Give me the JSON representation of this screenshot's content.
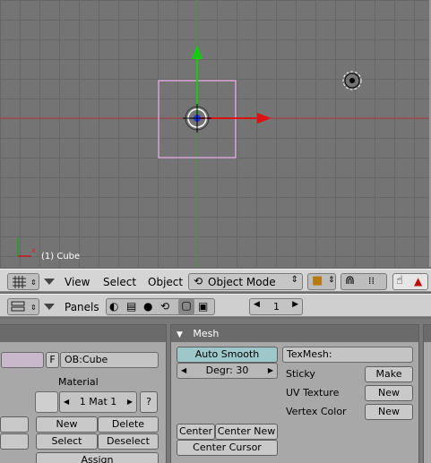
{
  "viewport": {
    "object_label": "(1) Cube"
  },
  "header": {
    "menus": [
      "View",
      "Select",
      "Object"
    ],
    "mode_label": "Object Mode"
  },
  "buttons_header": {
    "panels_label": "Panels",
    "frame_value": "1"
  },
  "link_panel": {
    "f_label": "F",
    "object_name": "OB:Cube",
    "material_label": "Material",
    "material_slot": "1 Mat 1",
    "question_label": "?",
    "new_label": "New",
    "delete_label": "Delete",
    "select_label": "Select",
    "deselect_label": "Deselect",
    "assign_label": "Assign"
  },
  "mesh_panel": {
    "title": "Mesh",
    "auto_smooth_label": "Auto Smooth",
    "degr_label": "Degr: 30",
    "texmesh_label": "TexMesh:",
    "sticky_label": "Sticky",
    "sticky_button": "Make",
    "uv_label": "UV Texture",
    "uv_button": "New",
    "vcol_label": "Vertex Color",
    "vcol_button": "New",
    "center_label": "Center",
    "center_new_label": "Center New",
    "center_cursor_label": "Center Cursor"
  }
}
